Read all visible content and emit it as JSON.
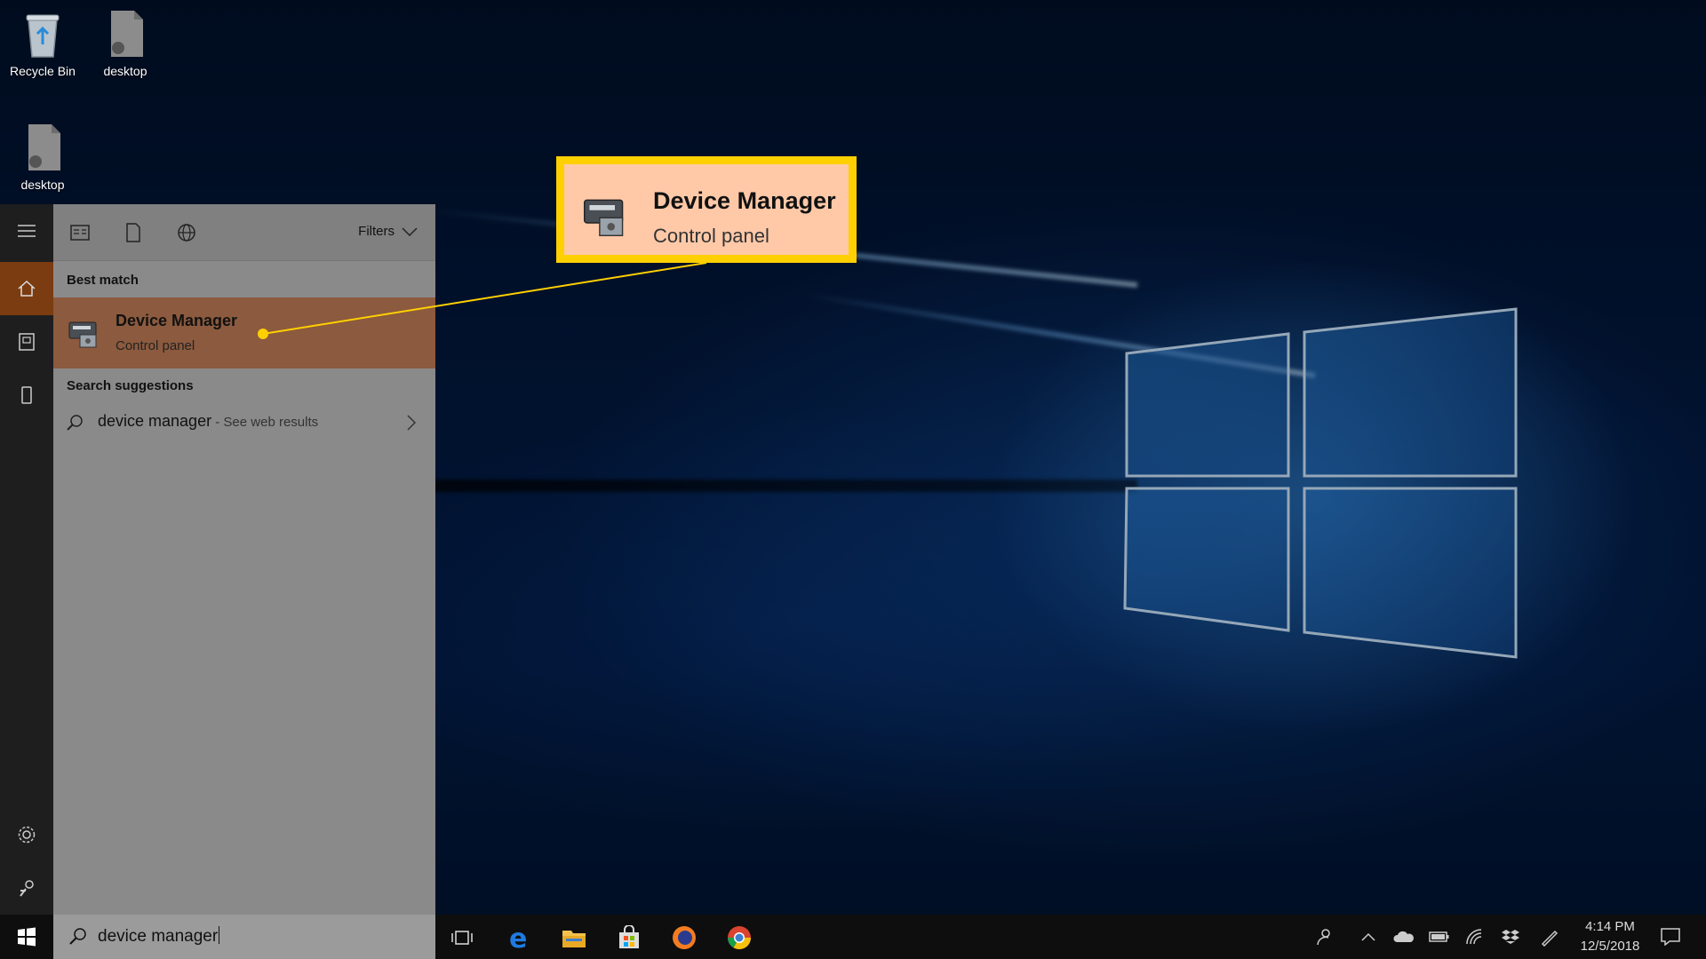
{
  "desktop": {
    "icons": [
      {
        "label": "Recycle Bin",
        "icon": "recycle-bin-icon"
      },
      {
        "label": "desktop",
        "icon": "file-icon"
      },
      {
        "label": "desktop",
        "icon": "file-icon"
      }
    ]
  },
  "search_panel": {
    "filters_label": "Filters",
    "best_match_label": "Best match",
    "best_match": {
      "title": "Device Manager",
      "subtitle": "Control panel",
      "icon": "device-manager-icon"
    },
    "suggestions_label": "Search suggestions",
    "suggestion": {
      "term": "device manager",
      "hint": " - See web results"
    },
    "query": "device manager"
  },
  "callout": {
    "title": "Device Manager",
    "subtitle": "Control panel"
  },
  "taskbar": {
    "apps": [
      "task-view-icon",
      "edge-icon",
      "file-explorer-icon",
      "store-icon",
      "firefox-icon",
      "chrome-icon"
    ],
    "tray": [
      "people-icon",
      "chevron-up-icon",
      "onedrive-icon",
      "battery-icon",
      "wifi-icon",
      "dropbox-icon",
      "pen-icon"
    ],
    "time": "4:14 PM",
    "date": "12/5/2018"
  },
  "colors": {
    "highlight": "#ffd000",
    "callout_fill": "#ffc9a8",
    "best_match_row": "#8c5a3e",
    "active_rail": "#7a3c10"
  }
}
